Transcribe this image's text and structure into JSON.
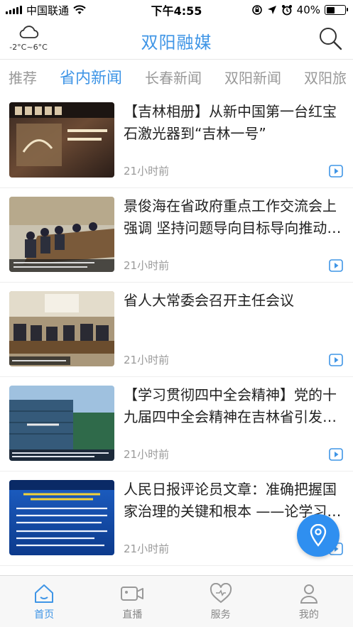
{
  "status_bar": {
    "carrier": "中国联通",
    "time": "下午4:55",
    "battery": "40%"
  },
  "header": {
    "weather_temp": "-2°C~6°C",
    "title": "双阳融媒"
  },
  "tabs": [
    {
      "label": "推荐"
    },
    {
      "label": "省内新闻",
      "active": true
    },
    {
      "label": "长春新闻"
    },
    {
      "label": "双阳新闻"
    },
    {
      "label": "双阳旅"
    }
  ],
  "news": [
    {
      "title": "【吉林相册】从新中国第一台红宝石激光器到“吉林一号”",
      "time": "21小时前",
      "icon": "video-play-icon"
    },
    {
      "title": "景俊海在省政府重点工作交流会上强调 坚持问题导向目标导向推动各项工作落实",
      "time": "21小时前",
      "icon": "video-play-icon"
    },
    {
      "title": "省人大常委会召开主任会议",
      "time": "21小时前",
      "icon": "video-play-icon"
    },
    {
      "title": "【学习贯彻四中全会精神】党的十九届四中全会精神在吉林省引发热烈反响",
      "time": "21小时前",
      "icon": "video-play-icon"
    },
    {
      "title": "人民日报评论员文章：准确把握国家治理的关键和根本 ——论学习贯彻党的十九届四中全会精神",
      "time": "21小时前",
      "icon": "video-play-icon"
    }
  ],
  "tabbar": [
    {
      "label": "首页",
      "icon": "home-icon",
      "active": true
    },
    {
      "label": "直播",
      "icon": "camera-icon"
    },
    {
      "label": "服务",
      "icon": "heart-icon"
    },
    {
      "label": "我的",
      "icon": "user-icon"
    }
  ],
  "colors": {
    "accent": "#3f95e6",
    "fab": "#2f8ff0"
  }
}
